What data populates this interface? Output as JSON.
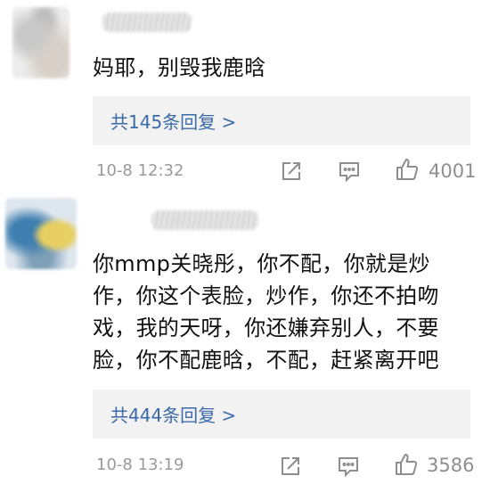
{
  "comments": [
    {
      "text_lines": [
        "妈耶，别毁我鹿晗"
      ],
      "replies_link": "共145条回复 >",
      "time": "10-8 12:32",
      "likes": "4001"
    },
    {
      "text_lines": [
        "你mmp关晓彤，你不配，你就是炒",
        "作，你这个表脸，炒作，你还不拍吻",
        "戏，我的天呀，你还嫌弃别人，不要",
        "脸，你不配鹿晗，不配，赶紧离开吧"
      ],
      "replies_link": "共444条回复 >",
      "time": "10-8 13:19",
      "likes": "3586"
    }
  ]
}
